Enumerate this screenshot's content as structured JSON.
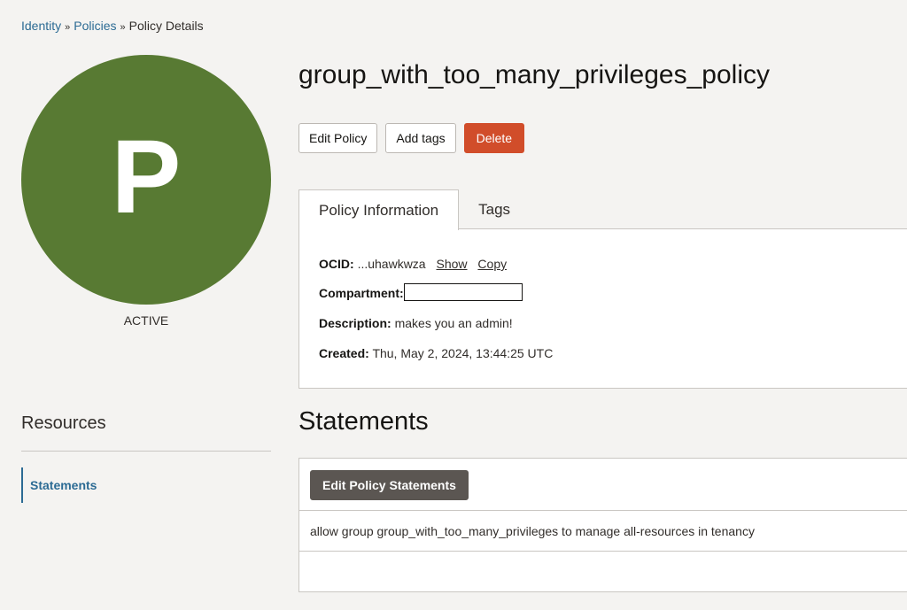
{
  "breadcrumb": {
    "items": [
      "Identity",
      "Policies",
      "Policy Details"
    ],
    "separator": "»"
  },
  "avatar": {
    "letter": "P",
    "color": "#587a33"
  },
  "status": "ACTIVE",
  "policy": {
    "name": "group_with_too_many_privileges_policy"
  },
  "actions": {
    "edit_label": "Edit Policy",
    "add_tags_label": "Add tags",
    "delete_label": "Delete",
    "delete_color": "#d14d2a"
  },
  "tabs": [
    {
      "label": "Policy Information",
      "active": true
    },
    {
      "label": "Tags",
      "active": false
    }
  ],
  "info": {
    "ocid_label": "OCID:",
    "ocid_value": "...uhawkwza",
    "show_label": "Show",
    "copy_label": "Copy",
    "compartment_label": "Compartment:",
    "compartment_value": "",
    "description_label": "Description:",
    "description_value": "makes you an admin!",
    "created_label": "Created:",
    "created_value": "Thu, May 2, 2024, 13:44:25 UTC"
  },
  "resources": {
    "title": "Resources",
    "items": [
      {
        "label": "Statements",
        "active": true
      }
    ]
  },
  "statements": {
    "title": "Statements",
    "edit_button_label": "Edit Policy Statements",
    "items": [
      "allow group group_with_too_many_privileges to manage all-resources in tenancy"
    ]
  },
  "colors": {
    "link": "#2c6b94",
    "accent_dark": "#5b5652"
  }
}
